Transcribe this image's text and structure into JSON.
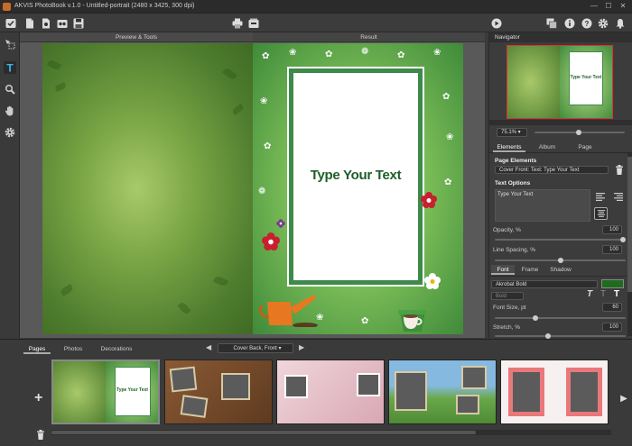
{
  "title": "AKVIS PhotoBook v.1.0 - Untitled-portrait (2480 x 3425, 300 dpi)",
  "window_controls": [
    "—",
    "☐",
    "✕"
  ],
  "canvas": {
    "left_header": "Preview & Tools",
    "right_header": "Result",
    "placeholder_text": "Type Your Text"
  },
  "navigator": {
    "header": "Navigator",
    "zoom": "75.1%",
    "thumb_text": "Type Your Text"
  },
  "panel_tabs": [
    "Elements",
    "Album",
    "Page"
  ],
  "page_elements": {
    "label": "Page Elements",
    "selected": "Cover Front: Text: Type Your Text"
  },
  "text_options": {
    "label": "Text Options",
    "value": "Type Your Text",
    "opacity_label": "Opacity, %",
    "opacity_value": "100",
    "opacity_level": 1.0,
    "line_spacing_label": "Line Spacing, %",
    "line_spacing_value": "100",
    "line_spacing_level": 0.5
  },
  "font_tabs": [
    "Font",
    "Frame",
    "Shadow"
  ],
  "font": {
    "family": "Akrobat Bold",
    "style": "Bold",
    "color": "#1f6b1f",
    "size_label": "Font Size, pt",
    "size_value": "60",
    "size_level": 0.3,
    "stretch_label": "Stretch, %",
    "stretch_value": "100",
    "stretch_level": 0.4,
    "style_icons": [
      "T",
      "T",
      "T"
    ]
  },
  "bottom": {
    "tabs": [
      "Pages",
      "Photos",
      "Decorations"
    ],
    "active_tab": "Pages",
    "page_selector": "Cover Back, Front",
    "thumb_text": "Type Your Text"
  }
}
